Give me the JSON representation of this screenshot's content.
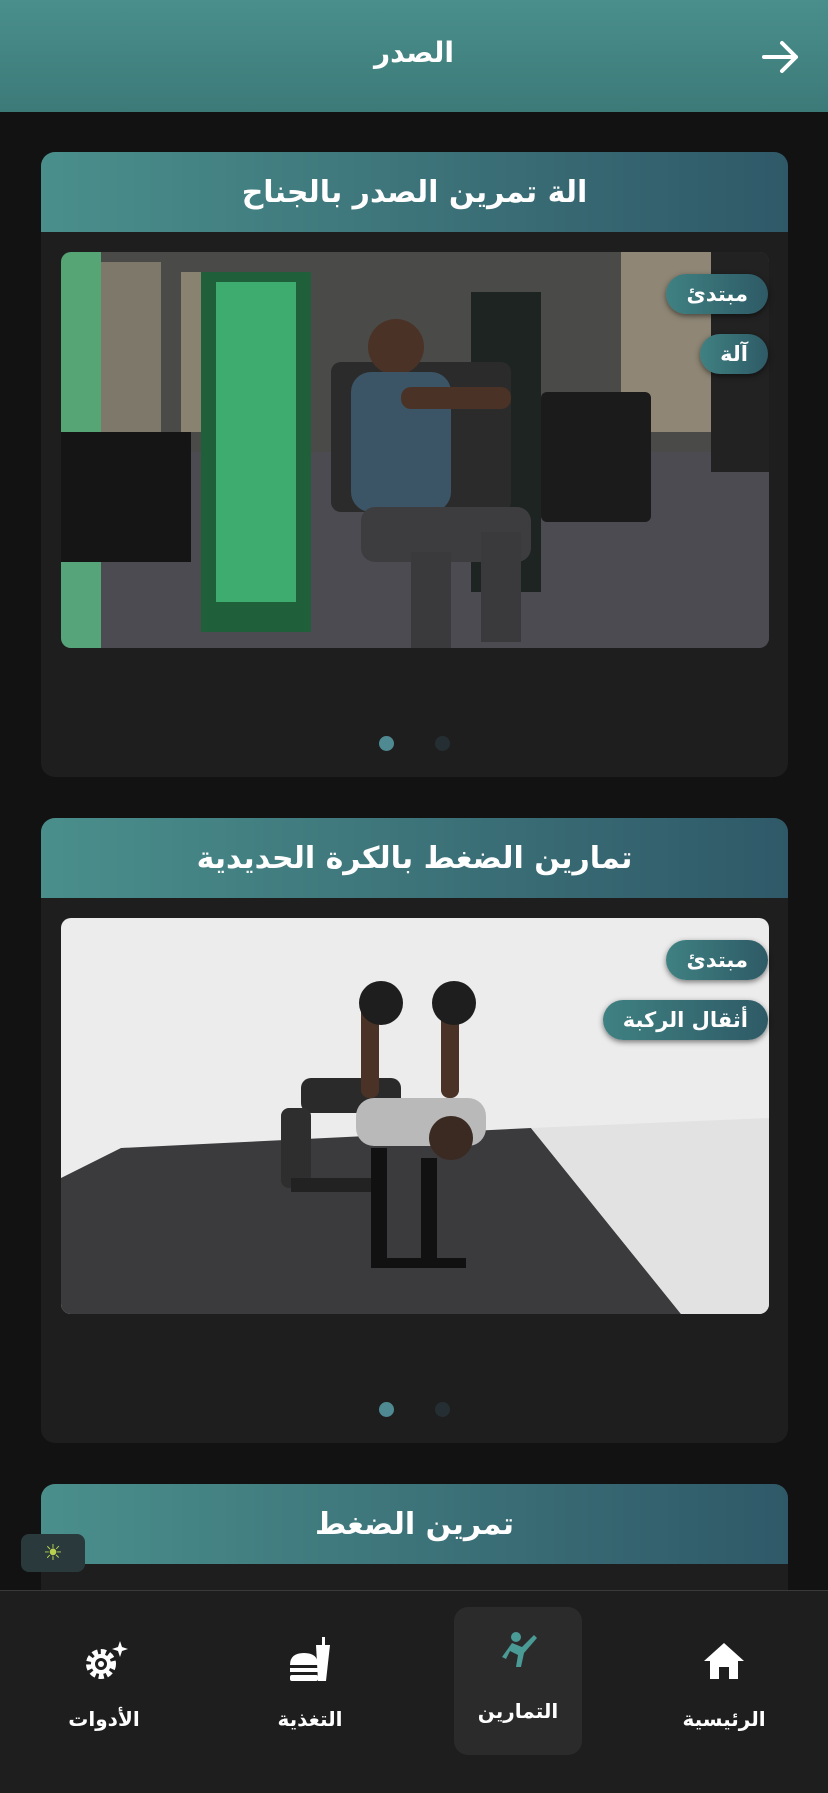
{
  "header": {
    "title": "الصدر"
  },
  "cards": [
    {
      "title": "الة تمرين الصدر بالجناح",
      "tags": [
        "مبتدئ",
        "آلة"
      ]
    },
    {
      "title": "تمارين الضغط بالكرة الحديدية",
      "tags": [
        "مبتدئ",
        "أثقال الركبة"
      ]
    },
    {
      "title": "تمرين الضغط"
    }
  ],
  "nav": {
    "home": "الرئيسية",
    "workouts": "التمارين",
    "nutrition": "التغذية",
    "tools": "الأدوات"
  },
  "colors": {
    "accent": "#4a8f8c",
    "background": "#121212",
    "card": "#1e1e1e"
  }
}
